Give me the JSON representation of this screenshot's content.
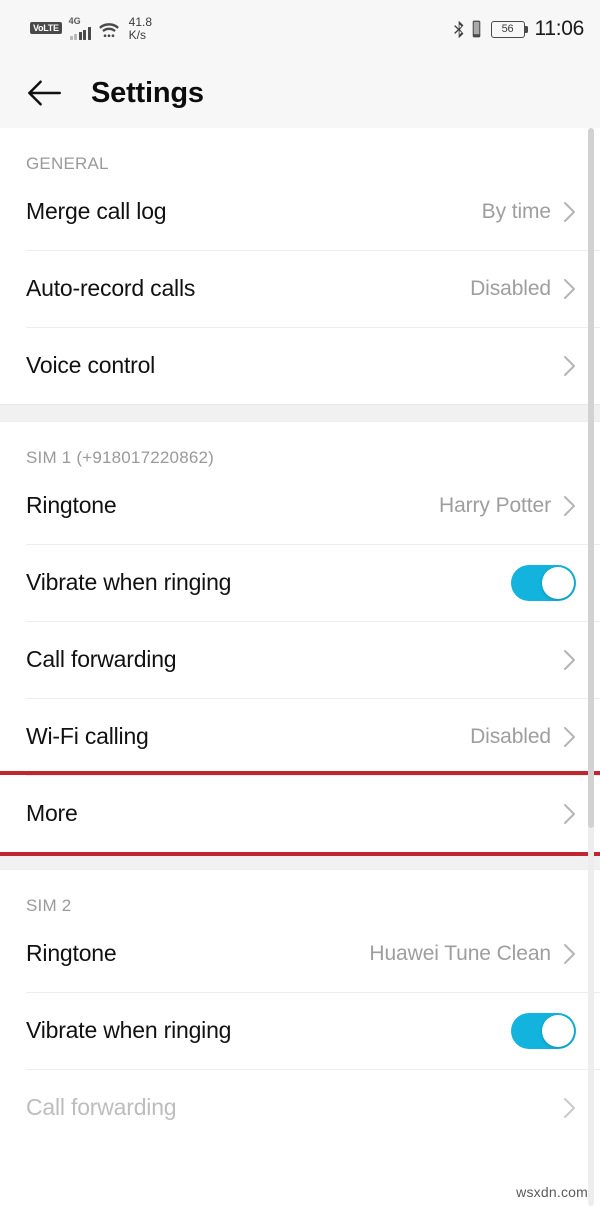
{
  "status_bar": {
    "volte_label": "VoLTE",
    "network_type": "4G",
    "net_speed_value": "41.8",
    "net_speed_unit": "K/s",
    "battery_percent": "56",
    "time": "11:06",
    "icons": [
      "volte-badge",
      "signal-bars-icon",
      "wifi-icon",
      "bluetooth-icon",
      "vibrate-icon",
      "battery-icon"
    ]
  },
  "app_bar": {
    "back_icon": "back-arrow-icon",
    "title": "Settings"
  },
  "sections": [
    {
      "header": "GENERAL",
      "rows": [
        {
          "label": "Merge call log",
          "value": "By time",
          "control": "chevron",
          "disabled": false
        },
        {
          "label": "Auto-record calls",
          "value": "Disabled",
          "control": "chevron",
          "disabled": false
        },
        {
          "label": "Voice control",
          "value": "",
          "control": "chevron",
          "disabled": false
        }
      ]
    },
    {
      "header": "SIM 1 (+918017220862)",
      "rows": [
        {
          "label": "Ringtone",
          "value": "Harry Potter",
          "control": "chevron",
          "disabled": false
        },
        {
          "label": "Vibrate when ringing",
          "value": "",
          "control": "toggle-on",
          "disabled": false
        },
        {
          "label": "Call forwarding",
          "value": "",
          "control": "chevron",
          "disabled": false
        },
        {
          "label": "Wi-Fi calling",
          "value": "Disabled",
          "control": "chevron",
          "disabled": false
        },
        {
          "label": "More",
          "value": "",
          "control": "chevron",
          "disabled": false,
          "highlighted": true
        }
      ]
    },
    {
      "header": "SIM 2",
      "rows": [
        {
          "label": "Ringtone",
          "value": "Huawei Tune Clean",
          "control": "chevron",
          "disabled": false
        },
        {
          "label": "Vibrate when ringing",
          "value": "",
          "control": "toggle-on",
          "disabled": false
        },
        {
          "label": "Call forwarding",
          "value": "",
          "control": "chevron",
          "disabled": true
        }
      ]
    }
  ],
  "colors": {
    "toggle_on": "#12b3dd",
    "highlight_box": "#c0262f",
    "section_gap": "#f1f1f1",
    "app_bar_bg": "#f7f7f8"
  },
  "watermark": "wsxdn.com"
}
